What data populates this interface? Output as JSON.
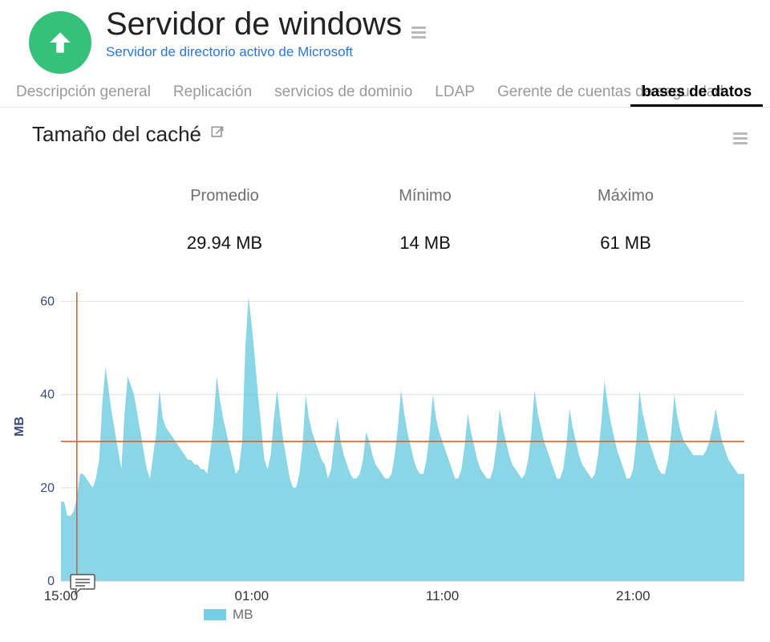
{
  "header": {
    "title": "Servidor de windows",
    "subtitle": "Servidor de directorio activo de Microsoft"
  },
  "tabs": [
    {
      "label": "Descripción general"
    },
    {
      "label": "Replicación"
    },
    {
      "label": "servicios de dominio"
    },
    {
      "label": "LDAP"
    },
    {
      "label": "Gerente de cuentas de seguridad"
    },
    {
      "label": "bases de datos"
    }
  ],
  "active_tab_index": 5,
  "panel": {
    "title": "Tamaño del caché",
    "stats": [
      {
        "label": "Promedio",
        "value": "29.94 MB"
      },
      {
        "label": "Mínimo",
        "value": "14 MB"
      },
      {
        "label": "Máximo",
        "value": "61 MB"
      }
    ],
    "legend": "MB",
    "ylabel": "MB"
  },
  "chart_data": {
    "type": "area",
    "title": "Tamaño del caché",
    "ylabel": "MB",
    "xlabel": "",
    "ylim": [
      0,
      62
    ],
    "yticks": [
      0,
      20,
      40,
      60
    ],
    "x_tick_labels": [
      "15:00",
      "01:00",
      "11:00",
      "21:00"
    ],
    "x_tick_positions": [
      0,
      60,
      120,
      180
    ],
    "cursor_x": 5,
    "avg_line": 29.94,
    "series": [
      {
        "name": "MB",
        "color": "#76cfe2",
        "x_step_minutes": 6,
        "values": [
          17,
          17,
          14,
          14,
          15,
          18,
          23,
          23,
          22,
          21,
          20,
          22,
          26,
          38,
          46,
          41,
          36,
          32,
          28,
          24,
          36,
          44,
          42,
          40,
          36,
          32,
          28,
          24,
          22,
          27,
          32,
          41,
          35,
          33,
          32,
          31,
          30,
          29,
          28,
          27,
          26,
          26,
          25,
          25,
          24,
          24,
          23,
          28,
          34,
          44,
          39,
          35,
          32,
          29,
          26,
          23,
          24,
          30,
          50,
          61,
          55,
          48,
          40,
          33,
          26,
          24,
          27,
          35,
          41,
          35,
          30,
          26,
          22,
          20,
          20,
          23,
          29,
          40,
          35,
          32,
          30,
          28,
          26,
          25,
          22,
          24,
          30,
          35,
          30,
          27,
          25,
          23,
          22,
          22,
          23,
          26,
          32,
          30,
          27,
          25,
          24,
          23,
          22,
          22,
          23,
          27,
          33,
          41,
          36,
          32,
          29,
          26,
          24,
          23,
          23,
          26,
          32,
          40,
          35,
          32,
          30,
          28,
          26,
          24,
          22,
          22,
          24,
          29,
          36,
          32,
          29,
          26,
          24,
          23,
          22,
          22,
          24,
          29,
          37,
          33,
          30,
          27,
          25,
          24,
          23,
          22,
          23,
          26,
          32,
          41,
          36,
          33,
          30,
          28,
          26,
          24,
          22,
          22,
          24,
          29,
          37,
          33,
          30,
          27,
          25,
          24,
          23,
          22,
          23,
          27,
          34,
          43,
          38,
          34,
          31,
          28,
          26,
          24,
          22,
          22,
          24,
          30,
          41,
          36,
          33,
          30,
          28,
          26,
          24,
          23,
          23,
          26,
          32,
          40,
          35,
          32,
          30,
          29,
          28,
          27,
          27,
          27,
          27,
          28,
          30,
          33,
          37,
          33,
          30,
          28,
          26,
          25,
          24,
          23,
          23,
          23
        ]
      }
    ]
  }
}
